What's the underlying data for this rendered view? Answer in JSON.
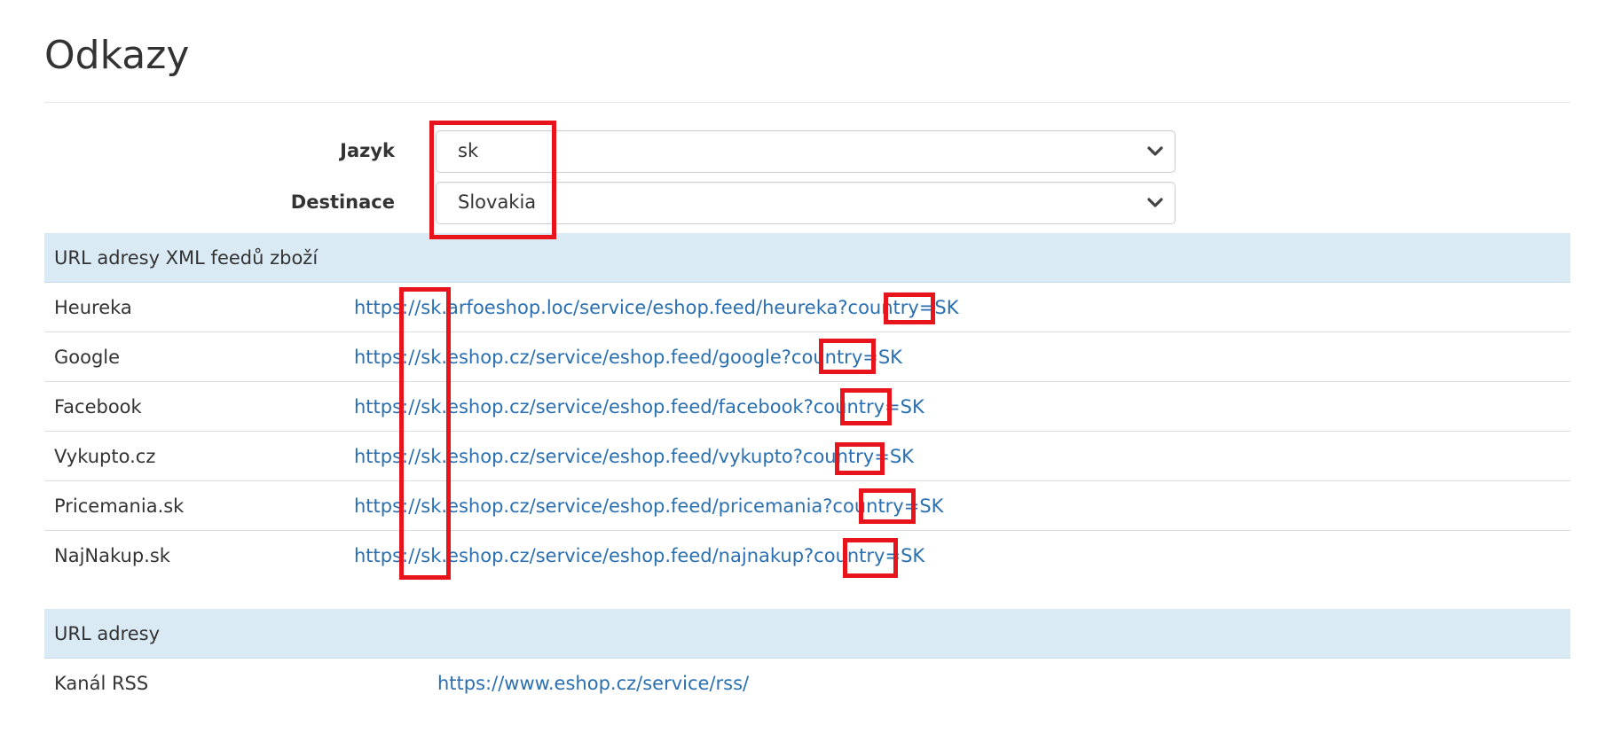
{
  "page": {
    "title": "Odkazy"
  },
  "filters": {
    "language": {
      "label": "Jazyk",
      "value": "sk"
    },
    "destination": {
      "label": "Destinace",
      "value": "Slovakia"
    }
  },
  "feeds_section": {
    "header": "URL adresy XML feedů zboží",
    "rows": [
      {
        "name": "Heureka",
        "url": "https://sk.arfoeshop.loc/service/eshop.feed/heureka?country=SK"
      },
      {
        "name": "Google",
        "url": "https://sk.eshop.cz/service/eshop.feed/google?country=SK"
      },
      {
        "name": "Facebook",
        "url": "https://sk.eshop.cz/service/eshop.feed/facebook?country=SK"
      },
      {
        "name": "Vykupto.cz",
        "url": "https://sk.eshop.cz/service/eshop.feed/vykupto?country=SK"
      },
      {
        "name": "Pricemania.sk",
        "url": "https://sk.eshop.cz/service/eshop.feed/pricemania?country=SK"
      },
      {
        "name": "NajNakup.sk",
        "url": "https://sk.eshop.cz/service/eshop.feed/najnakup?country=SK"
      }
    ]
  },
  "urls_section": {
    "header": "URL adresy",
    "rows": [
      {
        "name": "Kanál RSS",
        "url": "https://www.eshop.cz/service/rss/"
      }
    ]
  },
  "icons": {
    "select_arrow": "chevron-down-icon"
  },
  "colors": {
    "link": "#2a6fb0",
    "section_header_bg": "#d9eaf5",
    "annotation": "#e8141c"
  }
}
